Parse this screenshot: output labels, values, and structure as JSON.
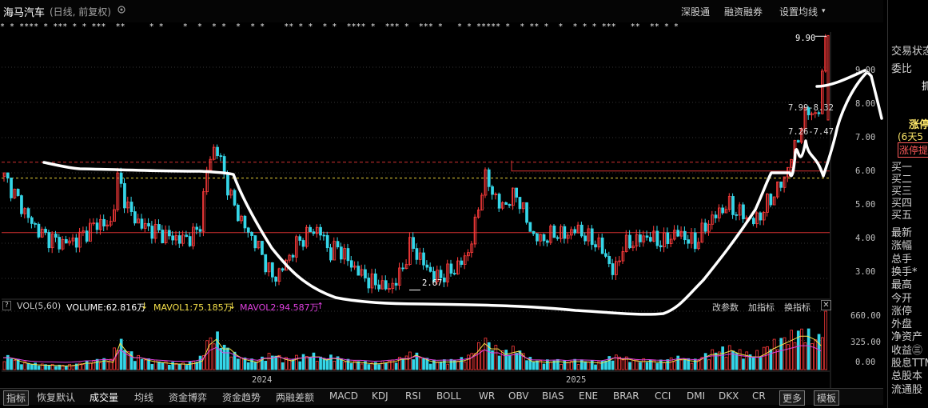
{
  "header": {
    "stock_name": "海马汽车",
    "period_info": "(日线, 前复权)",
    "buttons": [
      "深股通",
      "融资融券",
      "设置均线"
    ]
  },
  "markers_row": "* * **** * *** * * ***  **     * *    *  *  * *  *  * *    ** * *  * *  **** *  *** *  *** *   * * ***** *  * ** *  *  * * * ***   **  ** * *",
  "price_axis": [
    "9.00",
    "8.00",
    "7.00",
    "6.00",
    "5.00",
    "4.00",
    "3.00"
  ],
  "price_annotations": {
    "high": "9.90",
    "low": "2.67",
    "range1": "7.99-8.32",
    "range2": "7.26-7.47"
  },
  "volume_bar": {
    "header_icon": "?",
    "label": "VOL(5,60)",
    "volume": "VOLUME:62.816万",
    "mavol1": "MAVOL1:75.185万",
    "mavol2": "MAVOL2:94.587万",
    "buttons": [
      "改参数",
      "加指标",
      "换指标"
    ]
  },
  "volume_axis": [
    "660.00",
    "325.00",
    "0.00"
  ],
  "time_axis": [
    "2024",
    "2025"
  ],
  "right_panel": {
    "trading_status": "交易状态",
    "wei_bi": "委比",
    "grab_button": "抓",
    "limit_up": "涨停",
    "limit_days": "(6天5",
    "limit_tag": "涨停提",
    "buy_levels": [
      "买一",
      "买二",
      "买三",
      "买四",
      "买五"
    ],
    "stats": [
      "最新",
      "涨幅",
      "总手",
      "换手*",
      "最高",
      "今开",
      "涨停",
      "外盘",
      "净资产",
      "收益㊂",
      "股息TTM",
      "总股本",
      "流通股"
    ]
  },
  "bottom_tabs": [
    "指标",
    "恢复默认",
    "成交量",
    "均线",
    "资金博弈",
    "资金趋势",
    "两融差额",
    "MACD",
    "KDJ",
    "RSI",
    "BOLL",
    "WR",
    "OBV",
    "BIAS",
    "ENE",
    "BRAR",
    "CCI",
    "DMI",
    "DKX",
    "CR",
    "更多",
    "模板"
  ],
  "colors": {
    "up": "#ff3b3b",
    "down": "#35d6e8",
    "ma_yellow": "#f5e04a",
    "ma_magenta": "#e040e0",
    "drawing": "#ffffff"
  },
  "chart_data": {
    "type": "candlestick",
    "ylim": [
      2.5,
      10.0
    ],
    "reference_lines": [
      6.3,
      5.85,
      4.3
    ],
    "price_close_series": [
      5.9,
      5.5,
      5.1,
      4.7,
      4.4,
      4.2,
      4.1,
      4.0,
      4.05,
      4.1,
      4.3,
      4.5,
      4.6,
      4.4,
      5.9,
      5.1,
      4.7,
      4.5,
      4.4,
      4.3,
      4.2,
      4.15,
      4.1,
      4.2,
      4.4,
      6.2,
      6.8,
      6.0,
      5.2,
      4.7,
      4.3,
      4.0,
      3.5,
      3.0,
      3.2,
      3.6,
      4.0,
      4.2,
      4.4,
      4.3,
      3.7,
      3.9,
      3.6,
      3.3,
      3.1,
      2.9,
      2.8,
      2.7,
      2.85,
      3.3,
      4.0,
      3.6,
      3.3,
      3.0,
      3.1,
      3.2,
      3.4,
      3.7,
      4.6,
      5.9,
      5.5,
      5.0,
      5.2,
      5.4,
      4.8,
      4.2,
      4.1,
      4.2,
      4.3,
      4.2,
      4.4,
      4.3,
      4.1,
      4.0,
      3.6,
      3.1,
      3.9,
      4.0,
      4.1,
      4.2,
      4.1,
      4.0,
      4.2,
      4.3,
      4.1,
      4.0,
      4.4,
      4.7,
      4.9,
      5.1,
      4.9,
      4.8,
      4.6,
      4.8,
      5.2,
      5.5,
      5.9,
      6.6,
      7.3,
      7.9,
      7.4,
      9.9
    ],
    "volume_series": [
      150,
      120,
      90,
      70,
      60,
      55,
      50,
      45,
      50,
      60,
      80,
      100,
      110,
      90,
      330,
      220,
      150,
      120,
      100,
      90,
      80,
      70,
      65,
      80,
      110,
      310,
      380,
      260,
      180,
      130,
      110,
      90,
      140,
      170,
      130,
      110,
      140,
      150,
      160,
      120,
      140,
      130,
      100,
      90,
      80,
      70,
      75,
      90,
      100,
      130,
      180,
      150,
      110,
      90,
      95,
      100,
      110,
      140,
      220,
      330,
      260,
      190,
      210,
      230,
      150,
      100,
      90,
      95,
      100,
      85,
      100,
      95,
      90,
      80,
      110,
      150,
      130,
      110,
      100,
      105,
      95,
      90,
      120,
      130,
      110,
      100,
      150,
      190,
      210,
      240,
      200,
      180,
      160,
      200,
      260,
      300,
      340,
      380,
      420,
      380,
      300,
      660
    ]
  }
}
